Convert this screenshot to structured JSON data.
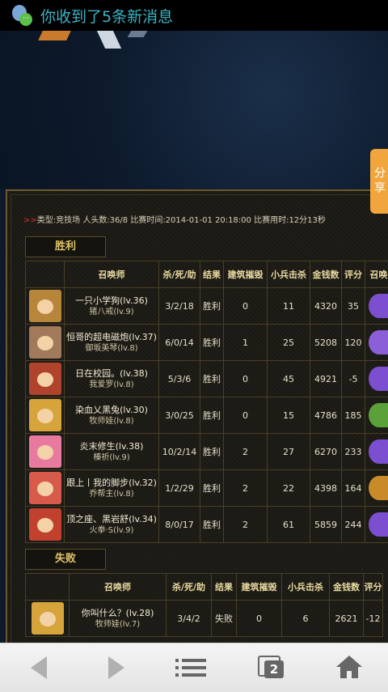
{
  "status_bar": {
    "notification_text": "你收到了5条新消息"
  },
  "share_tab": {
    "label": "分享"
  },
  "match": {
    "arrow": ">>",
    "info": "类型:竞技场 人头数:36/8 比赛时间:2014-01-01 20:18:00 比赛用时:12分13秒"
  },
  "victory": {
    "label": "胜利",
    "headers": [
      "",
      "召唤师",
      "杀/死/助",
      "结果",
      "建筑摧毁",
      "小兵击杀",
      "金钱数",
      "评分",
      "召唤"
    ],
    "rows": [
      {
        "name": "一只小学狗(lv.36)",
        "hero": "猪八戒(lv.9)",
        "kda": "3/2/18",
        "result": "胜利",
        "buildings": "0",
        "minions": "11",
        "gold": "4320",
        "score": "35",
        "avatar_color": "#b8863a",
        "item_color": "#7b4fd0"
      },
      {
        "name": "恒哥的超电磁炮(lv.37)",
        "hero": "御坂美琴(lv.8)",
        "kda": "6/0/14",
        "result": "胜利",
        "buildings": "1",
        "minions": "25",
        "gold": "5208",
        "score": "120",
        "avatar_color": "#a07a5a",
        "item_color": "#8a5fd8"
      },
      {
        "name": "日在校园。(lv.38)",
        "hero": "我爱罗(lv.8)",
        "kda": "5/3/6",
        "result": "胜利",
        "buildings": "0",
        "minions": "45",
        "gold": "4921",
        "score": "-5",
        "avatar_color": "#b0432c",
        "item_color": "#7b4fd0"
      },
      {
        "name": "染血乂黑兔(lv.30)",
        "hero": "牧师娃(lv.8)",
        "kda": "3/0/25",
        "result": "胜利",
        "buildings": "0",
        "minions": "15",
        "gold": "4786",
        "score": "185",
        "avatar_color": "#d6a43a",
        "item_color": "#5aa13a"
      },
      {
        "name": "炎末修生(lv.38)",
        "hero": "榛祈(lv.9)",
        "kda": "10/2/14",
        "result": "胜利",
        "buildings": "2",
        "minions": "27",
        "gold": "6270",
        "score": "233",
        "avatar_color": "#e87aa0",
        "item_color": "#7b4fd0"
      },
      {
        "name": "跟上丨我的脚步(lv.32)",
        "hero": "乔帮主(lv.8)",
        "kda": "1/2/29",
        "result": "胜利",
        "buildings": "2",
        "minions": "22",
        "gold": "4398",
        "score": "164",
        "avatar_color": "#d85a4a",
        "item_color": "#c98a2a"
      },
      {
        "name": "顶之座、黑岩舒(lv.34)",
        "hero": "火拳·S(lv.9)",
        "kda": "8/0/17",
        "result": "胜利",
        "buildings": "2",
        "minions": "61",
        "gold": "5859",
        "score": "244",
        "avatar_color": "#c2402e",
        "item_color": "#7b4fd0"
      }
    ]
  },
  "defeat": {
    "label": "失败",
    "headers": [
      "",
      "召唤师",
      "杀/死/助",
      "结果",
      "建筑摧毁",
      "小兵击杀",
      "金钱数",
      "评分"
    ],
    "rows": [
      {
        "name": "你叫什么？(lv.28)",
        "hero": "牧师娃(lv.7)",
        "kda": "3/4/2",
        "result": "失败",
        "buildings": "0",
        "minions": "6",
        "gold": "2621",
        "score": "-12",
        "avatar_color": "#d6a43a"
      }
    ]
  },
  "bottom_nav": {
    "tab_count": "2",
    "icons": [
      "back-icon",
      "forward-icon",
      "menu-icon",
      "tabs-icon",
      "home-icon"
    ]
  }
}
